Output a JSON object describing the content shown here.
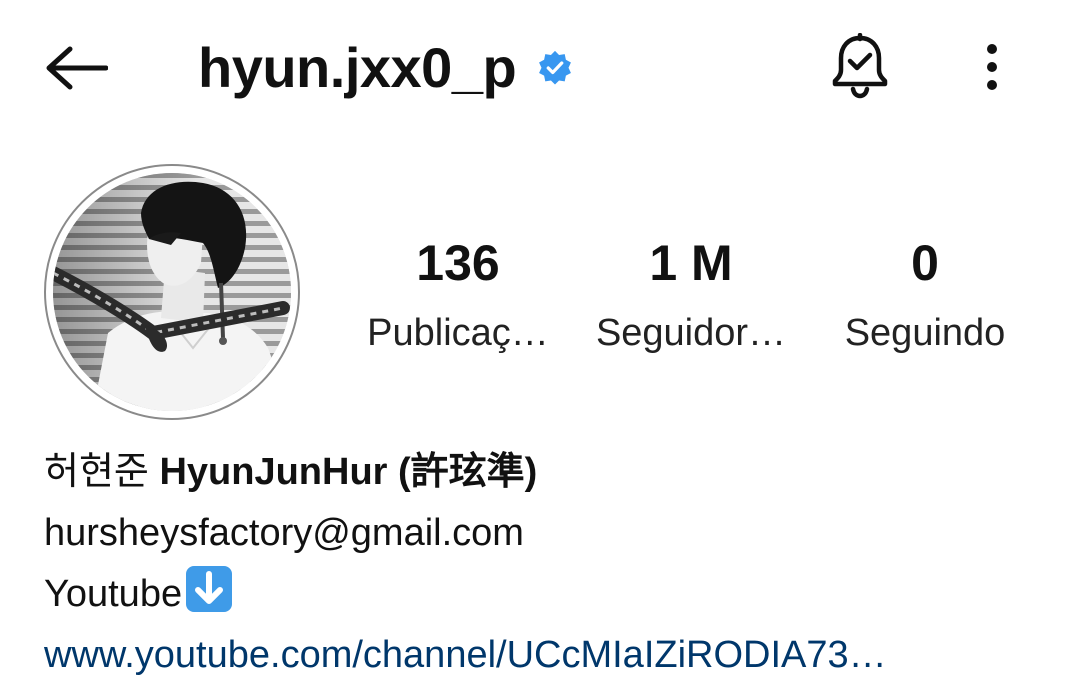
{
  "header": {
    "username": "hyun.jxx0_p",
    "back_icon": "arrow-left-icon",
    "verified_icon": "verified-badge-icon",
    "notification_icon": "bell-check-icon",
    "more_icon": "more-vertical-icon"
  },
  "profile": {
    "avatar": "profile-photo"
  },
  "stats": [
    {
      "value": "136",
      "label": "Publicaç…"
    },
    {
      "value": "1 M",
      "label": "Seguidor…"
    },
    {
      "value": "0",
      "label": "Seguindo"
    }
  ],
  "bio": {
    "name_korean": "허현준 ",
    "name_english": "HyunJunHur",
    "name_hanja": " (許玹準)",
    "email": "hursheysfactory@gmail.com",
    "youtube_text": "Youtube",
    "youtube_emoji": "down-arrow-emoji",
    "link": "www.youtube.com/channel/UCcMIaIZiRODIA73…"
  },
  "colors": {
    "verified_blue": "#3897f0",
    "link_blue": "#00376b",
    "emoji_blue": "#3f9be8",
    "text": "#111111"
  }
}
